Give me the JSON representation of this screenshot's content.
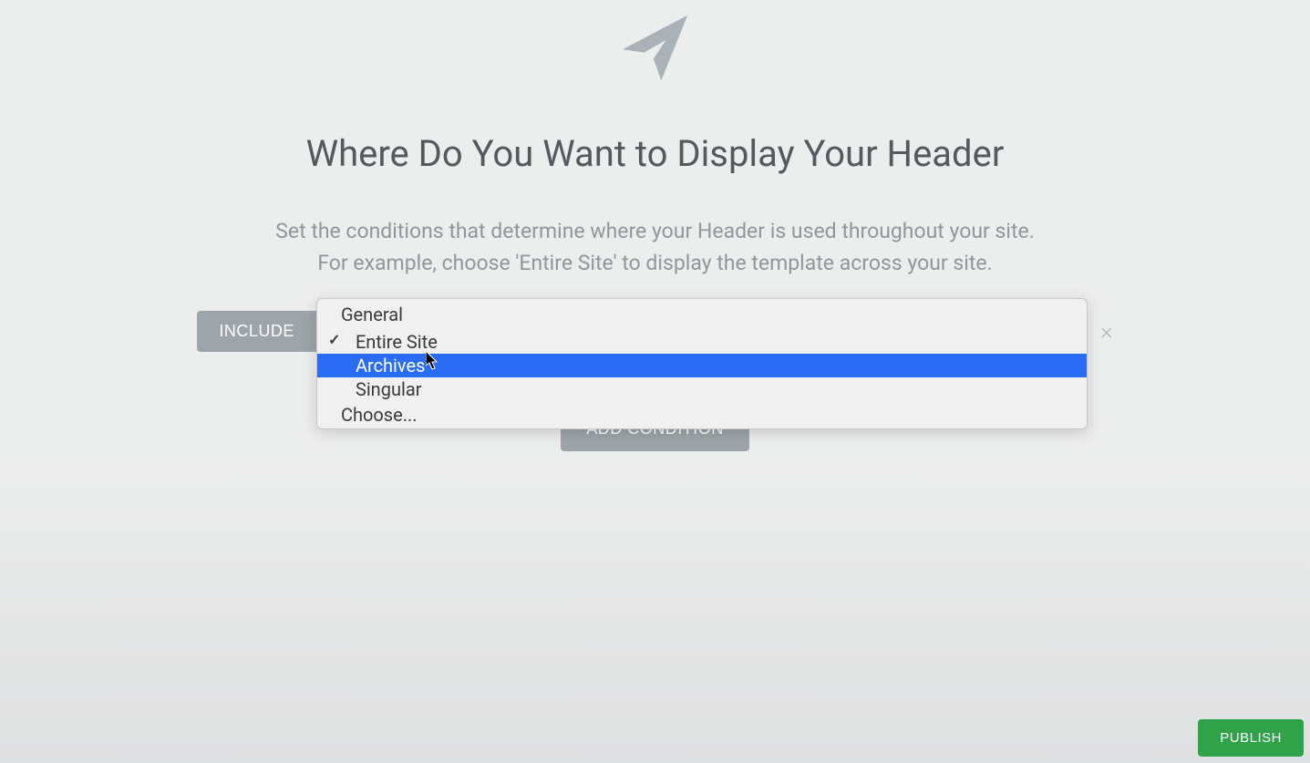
{
  "header": {
    "title": "Where Do You Want to Display Your Header",
    "description_line1": "Set the conditions that determine where your Header is used throughout your site.",
    "description_line2": "For example, choose 'Entire Site' to display the template across your site."
  },
  "condition": {
    "include_label": "INCLUDE",
    "close_label": "×"
  },
  "dropdown": {
    "group_label": "General",
    "items": [
      {
        "label": "Entire Site",
        "checked": true,
        "highlighted": false
      },
      {
        "label": "Archives",
        "checked": false,
        "highlighted": true
      },
      {
        "label": "Singular",
        "checked": false,
        "highlighted": false
      }
    ],
    "choose_label": "Choose..."
  },
  "buttons": {
    "add_condition": "ADD CONDITION",
    "publish": "PUBLISH"
  }
}
